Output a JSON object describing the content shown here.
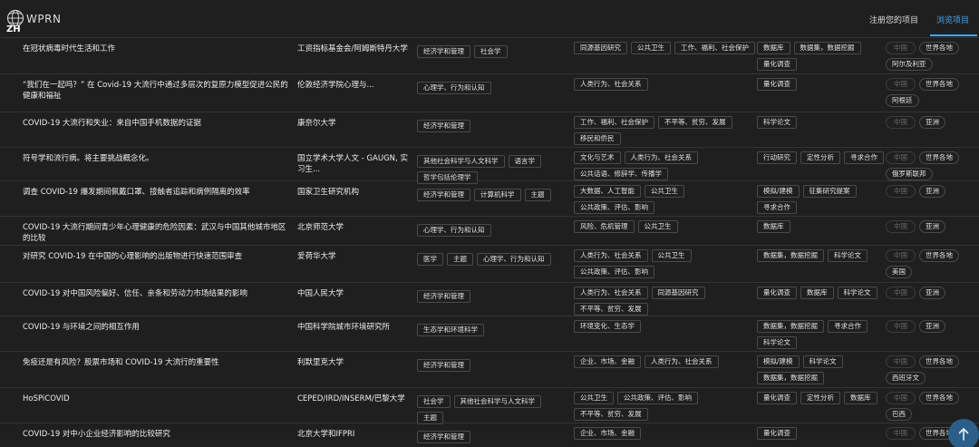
{
  "header": {
    "logo_text": "WPRN",
    "logo_sub": "ZH",
    "nav_register": "注册您的项目",
    "nav_browse": "浏览项目"
  },
  "rows": [
    {
      "title": "在冠状病毒时代生活和工作",
      "institution": "工资指标基金会/阿姆斯特丹大学",
      "disciplines": [
        "经济学和管理",
        "社会学"
      ],
      "topics": [
        "同源基因研究",
        "公共卫生",
        "工作、福利、社会保护"
      ],
      "methods": [
        "数据库",
        "数据集，数据挖掘",
        "量化调查"
      ],
      "china": "中国",
      "regions": [
        "世界各地",
        "阿尔及利亚"
      ]
    },
    {
      "title": "“我们在一起吗？” 在 Covid-19 大流行中通过多层次的复原力模型促进公民的健康和福祉",
      "institution": "伦敦经济学院心理与...",
      "disciplines": [
        "心理学、行为和认知"
      ],
      "topics": [
        "人类行为、社会关系"
      ],
      "methods": [
        "量化调查"
      ],
      "china": "中国",
      "regions": [
        "世界各地",
        "阿根廷"
      ]
    },
    {
      "title": "COVID-19 大流行和失业：来自中国手机数据的证据",
      "institution": "康奈尔大学",
      "disciplines": [
        "经济学和管理"
      ],
      "topics": [
        "工作、福利、社会保护",
        "不平等、贫穷、发展",
        "移民和侨民"
      ],
      "methods": [
        "科学论文"
      ],
      "china": "中国",
      "regions": [
        "亚洲"
      ]
    },
    {
      "title": "符号学和流行病。将主要挑战概念化。",
      "institution": "国立学术大学人文 - GAUGN, 实习生...",
      "disciplines": [
        "其他社会科学与人文科学",
        "语言学",
        "哲学包括伦理学"
      ],
      "topics": [
        "文化与艺术",
        "人类行为、社会关系",
        "公共话语、修辞学、传播学"
      ],
      "methods": [
        "行动研究",
        "定性分析",
        "寻求合作"
      ],
      "china": "中国",
      "regions": [
        "世界各地",
        "俄罗斯联邦"
      ]
    },
    {
      "title": "调查 COVID-19 爆发期间佩戴口罩、接触者追踪和病例隔离的效率",
      "institution": "国家卫生研究机构",
      "disciplines": [
        "经济学和管理",
        "计算机科学",
        "主题"
      ],
      "topics": [
        "大数据、人工智能",
        "公共卫生",
        "公共政策、评估、影响"
      ],
      "methods": [
        "模拟/建模",
        "征集研究提案",
        "寻求合作"
      ],
      "china": "中国",
      "regions": [
        "亚洲"
      ]
    },
    {
      "title": "COVID-19 大流行期间青少年心理健康的危险因素：武汉与中国其他城市地区的比较",
      "institution": "北京师范大学",
      "disciplines": [
        "心理学、行为和认知"
      ],
      "topics": [
        "风险、危机管理",
        "公共卫生"
      ],
      "methods": [
        "数据库"
      ],
      "china": "中国",
      "regions": [
        "亚洲"
      ]
    },
    {
      "title": "对研究 COVID-19 在中国的心理影响的出版物进行快速范围审查",
      "institution": "爱荷华大学",
      "disciplines": [
        "医学",
        "主题",
        "心理学、行为和认知"
      ],
      "topics": [
        "人类行为、社会关系",
        "公共卫生",
        "公共政策、评估、影响"
      ],
      "methods": [
        "数据集，数据挖掘",
        "科学论文"
      ],
      "china": "中国",
      "regions": [
        "世界各地",
        "美国"
      ]
    },
    {
      "title": "COVID-19 对中国风险偏好、信任、亲条和劳动力市场结果的影响",
      "institution": "中国人民大学",
      "disciplines": [
        "经济学和管理"
      ],
      "topics": [
        "人类行为、社会关系",
        "同源基因研究",
        "不平等、贫穷、发展"
      ],
      "methods": [
        "量化调查",
        "数据库",
        "科学论文"
      ],
      "china": "中国",
      "regions": [
        "亚洲"
      ]
    },
    {
      "title": "COVID-19 与环境之间的相互作用",
      "institution": "中国科学院城市环境研究所",
      "disciplines": [
        "生态学和环境科学"
      ],
      "topics": [
        "环境变化、生态学"
      ],
      "methods": [
        "数据集，数据挖掘",
        "寻求合作",
        "科学论文"
      ],
      "china": "中国",
      "regions": [
        "亚洲"
      ]
    },
    {
      "title": "免疫还是有风险？股票市场和 COVID-19 大流行的重要性",
      "institution": "利默里克大学",
      "disciplines": [
        "经济学和管理"
      ],
      "topics": [
        "企业、市场、金融",
        "人类行为、社会关系"
      ],
      "methods": [
        "模拟/建模",
        "科学论文",
        "数据集，数据挖掘"
      ],
      "china": "中国",
      "regions": [
        "世界各地",
        "西班牙文"
      ]
    },
    {
      "title": "HoSPiCOVID",
      "institution": "CEPED/IRD/INSERM/巴黎大学",
      "disciplines": [
        "社会学",
        "其他社会科学与人文科学",
        "主题"
      ],
      "topics": [
        "公共卫生",
        "公共政策、评估、影响",
        "不平等、贫穷、发展"
      ],
      "methods": [
        "量化调查",
        "定性分析",
        "数据库"
      ],
      "china": "中国",
      "regions": [
        "世界各地",
        "巴西"
      ]
    },
    {
      "title": "COVID-19 对中小企业经济影响的比较研究",
      "institution": "北京大学和IFPRI",
      "disciplines": [
        "经济学和管理"
      ],
      "topics": [
        "企业、市场、金融"
      ],
      "methods": [
        "量化调查"
      ],
      "china": "中国",
      "regions": [
        "世界各地"
      ]
    }
  ]
}
